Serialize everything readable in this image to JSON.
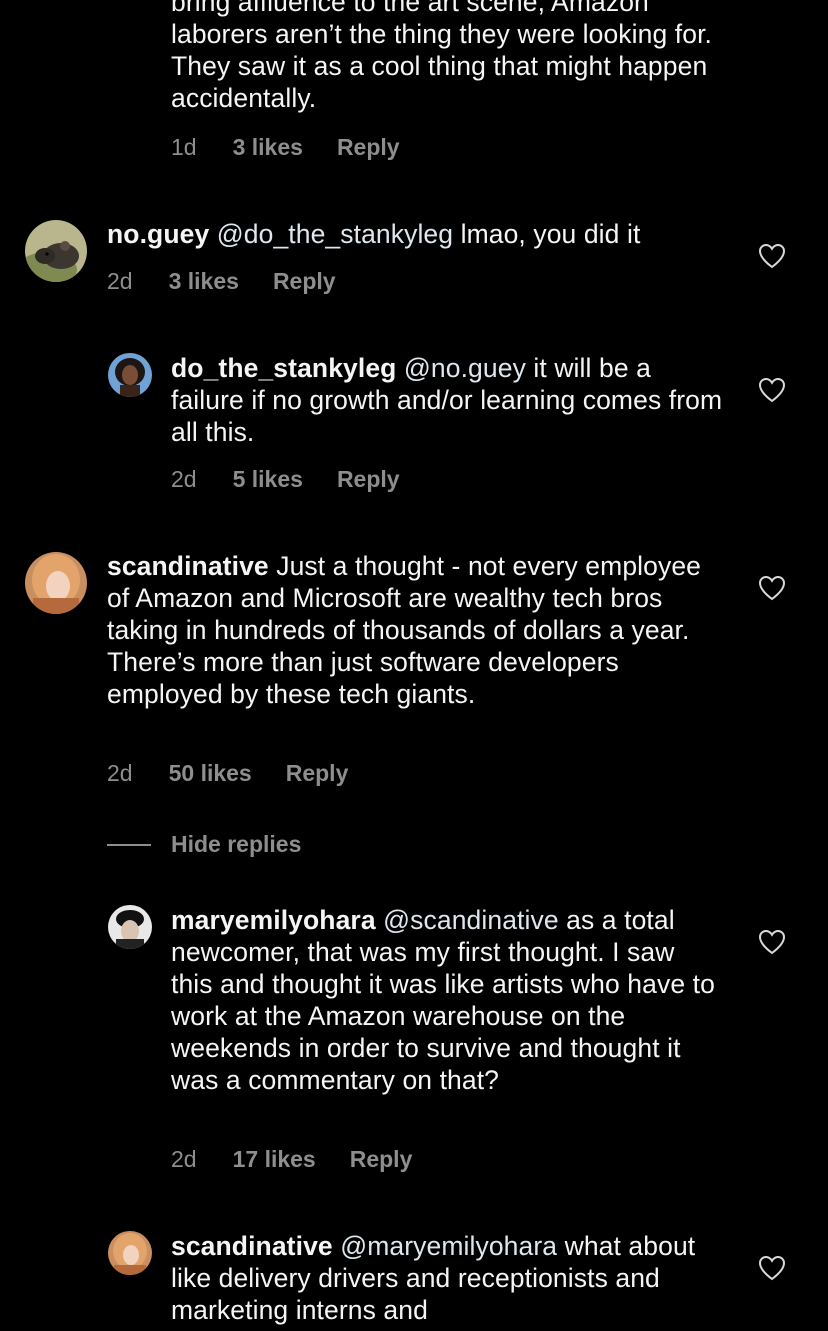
{
  "comments": [
    {
      "id": "c0",
      "username": "",
      "mention": "",
      "text": "bring affluence to the art scene, Amazon laborers aren’t the thing they were looking for. They saw it as a cool thing that might happen accidentally.",
      "time": "1d",
      "likes": "3 likes",
      "reply": "Reply"
    },
    {
      "id": "c1",
      "username": "no.guey",
      "mention": "@do_the_stankyleg",
      "text": "lmao, you did it",
      "time": "2d",
      "likes": "3 likes",
      "reply": "Reply",
      "avatar_icon": "rat-photo"
    },
    {
      "id": "c2",
      "username": "do_the_stankyleg",
      "mention": "@no.guey",
      "text": "it will be a failure if no growth and/or learning comes from all this.",
      "time": "2d",
      "likes": "5 likes",
      "reply": "Reply",
      "avatar_icon": "person-photo"
    },
    {
      "id": "c3",
      "username": "scandinative",
      "mention": "",
      "text": "Just a thought - not every employee of Amazon and Microsoft are wealthy tech bros taking in hundreds of thousands of dollars a year. There’s more than just software developers employed by these tech giants.",
      "time": "2d",
      "likes": "50 likes",
      "reply": "Reply",
      "avatar_icon": "person-photo"
    },
    {
      "id": "c4",
      "username": "maryemilyohara",
      "mention": "@scandinative",
      "text": "as a total newcomer, that was my first thought. I saw this and thought it was like artists who have to work at the Amazon warehouse on the weekends in order to survive and thought it was a commentary on that?",
      "time": "2d",
      "likes": "17 likes",
      "reply": "Reply",
      "avatar_icon": "person-photo"
    },
    {
      "id": "c5",
      "username": "scandinative",
      "mention": "@maryemilyohara",
      "text": "what about like delivery drivers and receptionists and marketing interns and",
      "avatar_icon": "person-photo"
    }
  ],
  "hide_replies_label": "Hide replies",
  "icons": {
    "heart": "heart-outline-icon"
  },
  "colors": {
    "background": "#000000",
    "text": "#f5f5f5",
    "meta": "#8e8e8e"
  }
}
